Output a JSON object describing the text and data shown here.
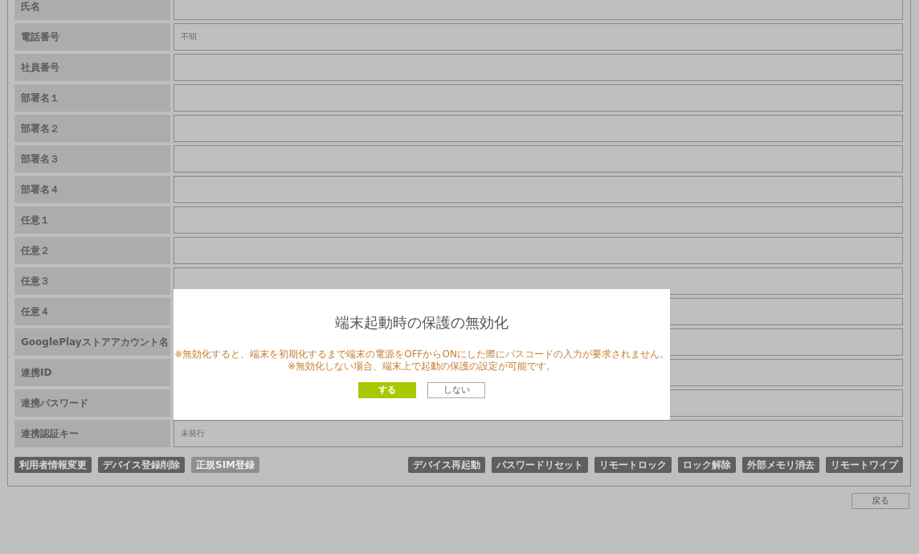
{
  "form": {
    "rows": [
      {
        "label": "氏名"
      },
      {
        "label": "電話番号",
        "value": "不明"
      },
      {
        "label": "社員番号"
      },
      {
        "label": "部署名１"
      },
      {
        "label": "部署名２"
      },
      {
        "label": "部署名３"
      },
      {
        "label": "部署名４"
      },
      {
        "label": "任意１"
      },
      {
        "label": "任意２"
      },
      {
        "label": "任意３"
      },
      {
        "label": "任意４"
      },
      {
        "label": "GooglePlayストアアカウント名"
      },
      {
        "label": "連携ID"
      },
      {
        "label": "連携パスワード"
      },
      {
        "label": "連携認証キー",
        "value": "未発行"
      }
    ],
    "left_buttons": [
      {
        "label": "利用者情報変更",
        "disabled": false
      },
      {
        "label": "デバイス登録削除",
        "disabled": false
      },
      {
        "label": "正規SIM登録",
        "disabled": true
      }
    ],
    "right_buttons": [
      {
        "label": "デバイス再起動",
        "disabled": false
      },
      {
        "label": "パスワードリセット",
        "disabled": false
      },
      {
        "label": "リモートロック",
        "disabled": false
      },
      {
        "label": "ロック解除",
        "disabled": false
      },
      {
        "label": "外部メモリ消去",
        "disabled": false
      },
      {
        "label": "リモートワイプ",
        "disabled": false
      }
    ]
  },
  "back_button": "戻る",
  "dialog": {
    "title": "端末起動時の保護の無効化",
    "notes": [
      "※無効化すると、端末を初期化するまで端末の電源をOFFからONにした際にパスコードの入力が要求されません。",
      "※無効化しない場合、端末上で起動の保護の設定が可能です。"
    ],
    "buttons": [
      {
        "label": "する",
        "kind": "primary"
      },
      {
        "label": "しない",
        "kind": "secondary"
      }
    ]
  }
}
